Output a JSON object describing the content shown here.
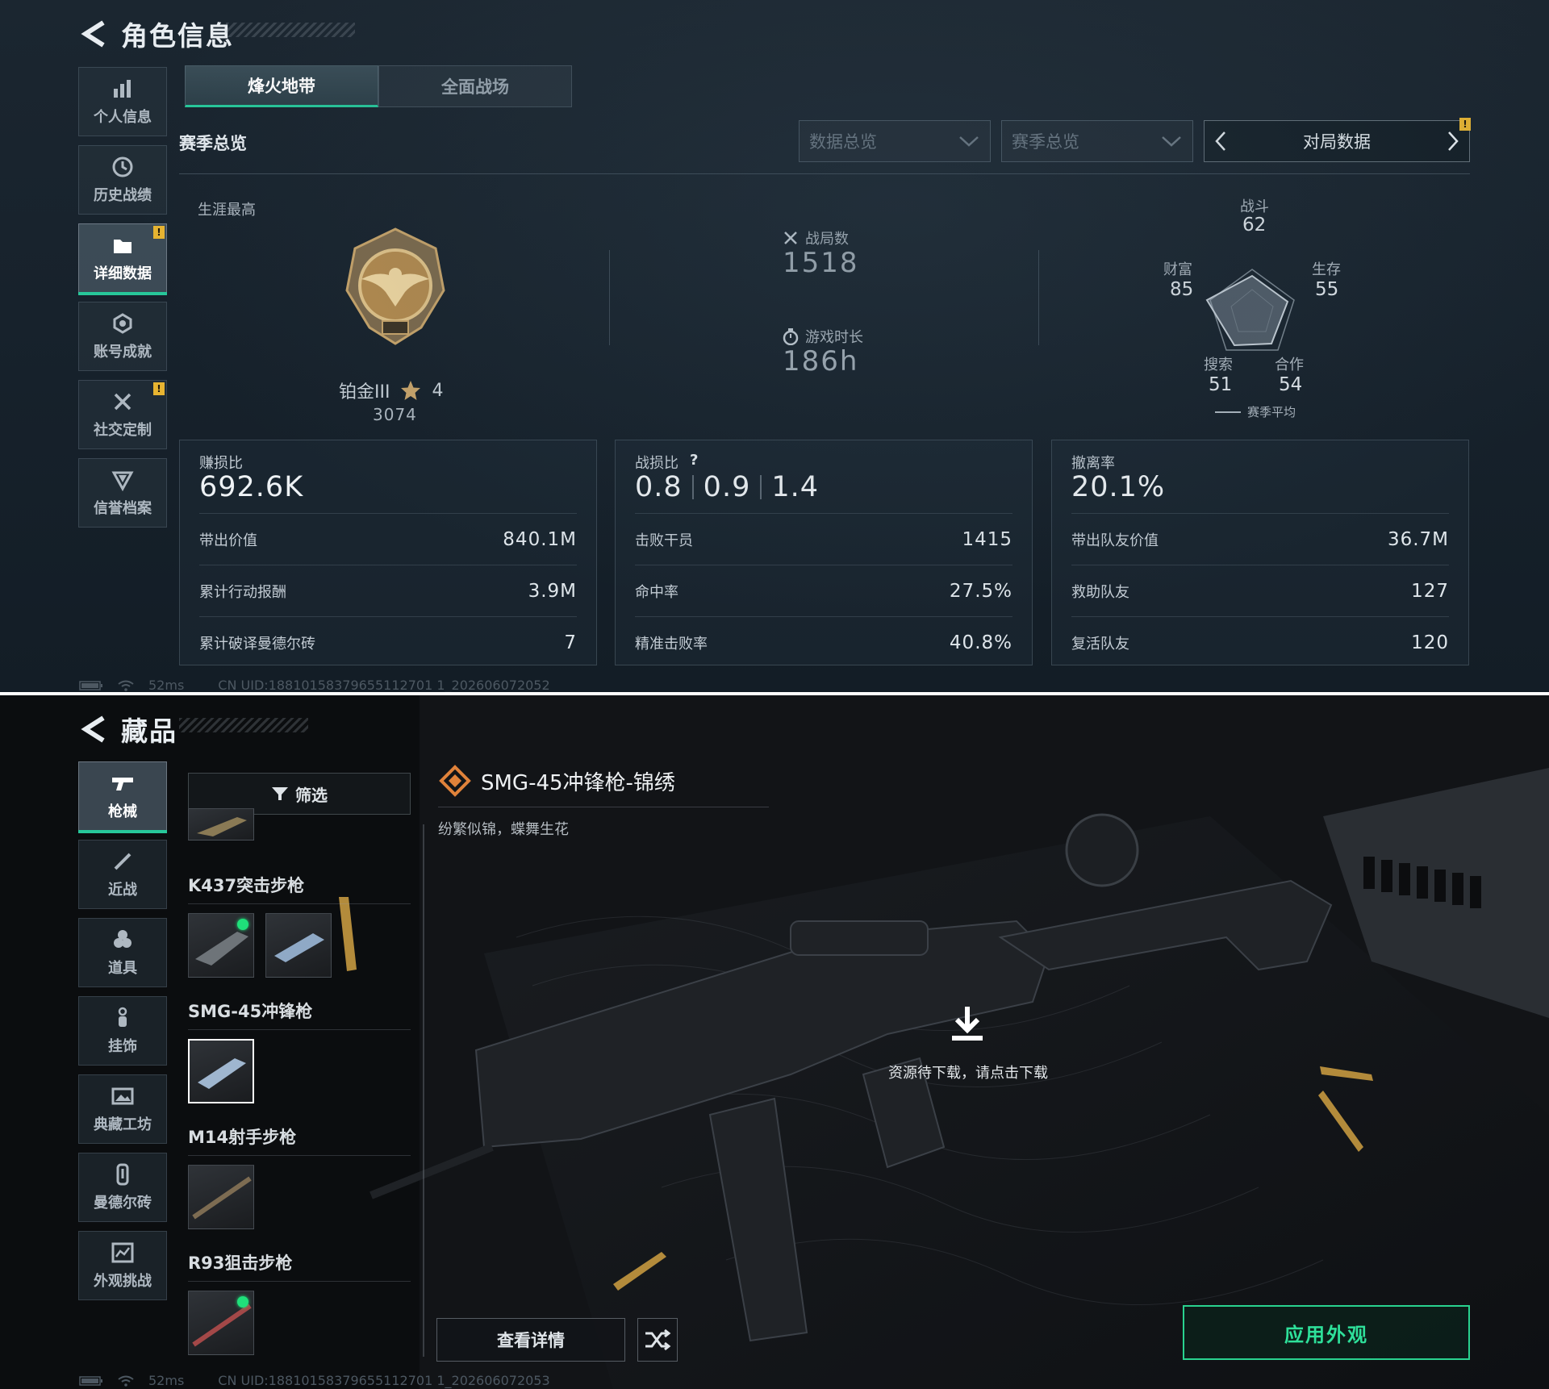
{
  "panel1": {
    "title": "角色信息",
    "sidebar": [
      {
        "label": "个人信息",
        "icon": "bar-chart-icon",
        "warn": false,
        "active": false
      },
      {
        "label": "历史战绩",
        "icon": "clock-icon",
        "warn": false,
        "active": false
      },
      {
        "label": "详细数据",
        "icon": "folder-icon",
        "warn": true,
        "active": true
      },
      {
        "label": "账号成就",
        "icon": "achievement-icon",
        "warn": false,
        "active": false
      },
      {
        "label": "社交定制",
        "icon": "tools-icon",
        "warn": true,
        "active": false
      },
      {
        "label": "信誉档案",
        "icon": "shield-icon",
        "warn": false,
        "active": false
      }
    ],
    "warn_badge": "!",
    "tabs": [
      {
        "label": "烽火地带",
        "active": true
      },
      {
        "label": "全面战场",
        "active": false
      }
    ],
    "section_label": "赛季总览",
    "dropdowns": [
      "数据总览",
      "赛季总览"
    ],
    "pager_label": "对局数据",
    "career_label": "生涯最高",
    "rank_name": "铂金III",
    "rank_stars": "4",
    "rank_points": "3074",
    "matches_label": "战局数",
    "matches_value": "1518",
    "playtime_label": "游戏时长",
    "playtime_value": "186h",
    "radar": {
      "labels": {
        "combat": "战斗",
        "survival": "生存",
        "cooperation": "合作",
        "search": "搜索",
        "wealth": "财富"
      },
      "values": {
        "combat": "62",
        "survival": "55",
        "cooperation": "54",
        "search": "51",
        "wealth": "85"
      },
      "legend": "赛季平均"
    },
    "cards": [
      {
        "label": "赚损比",
        "value": "692.6K",
        "rows": [
          {
            "k": "带出价值",
            "v": "840.1M"
          },
          {
            "k": "累计行动报酬",
            "v": "3.9M"
          },
          {
            "k": "累计破译曼德尔砖",
            "v": "7"
          }
        ]
      },
      {
        "label": "战损比",
        "value_parts": [
          "0.8",
          "0.9",
          "1.4"
        ],
        "help": "?",
        "rows": [
          {
            "k": "击败干员",
            "v": "1415"
          },
          {
            "k": "命中率",
            "v": "27.5%"
          },
          {
            "k": "精准击败率",
            "v": "40.8%"
          }
        ]
      },
      {
        "label": "撤离率",
        "value": "20.1%",
        "rows": [
          {
            "k": "带出队友价值",
            "v": "36.7M"
          },
          {
            "k": "救助队友",
            "v": "127"
          },
          {
            "k": "复活队友",
            "v": "120"
          }
        ]
      }
    ],
    "status_ping": "52ms",
    "status_uid": "CN UID:18810158379655112701 1_202606072052"
  },
  "panel2": {
    "title": "藏品",
    "sidebar": [
      {
        "label": "枪械",
        "icon": "gun-icon",
        "active": true
      },
      {
        "label": "近战",
        "icon": "knife-icon",
        "active": false
      },
      {
        "label": "道具",
        "icon": "grenade-icon",
        "active": false
      },
      {
        "label": "挂饰",
        "icon": "charm-icon",
        "active": false
      },
      {
        "label": "典藏工坊",
        "icon": "gallery-icon",
        "active": false
      },
      {
        "label": "曼德尔砖",
        "icon": "brick-icon",
        "active": false
      },
      {
        "label": "外观挑战",
        "icon": "challenge-icon",
        "active": false
      }
    ],
    "filter_label": "筛选",
    "weapons": [
      {
        "name": "K437突击步枪"
      },
      {
        "name": "SMG-45冲锋枪"
      },
      {
        "name": "M14射手步枪"
      },
      {
        "name": "R93狙击步枪"
      }
    ],
    "skin_title": "SMG-45冲锋枪-锦绣",
    "skin_desc": "纷繁似锦，蝶舞生花",
    "download_hint": "资源待下载，请点击下载",
    "detail_button": "查看详情",
    "apply_button": "应用外观",
    "status_ping": "52ms",
    "status_uid": "CN UID:18810158379655112701 1_202606072053"
  },
  "colors": {
    "accent_green": "#27c79a",
    "warn_yellow": "#e7b431",
    "online_dot": "#1fe07a"
  }
}
